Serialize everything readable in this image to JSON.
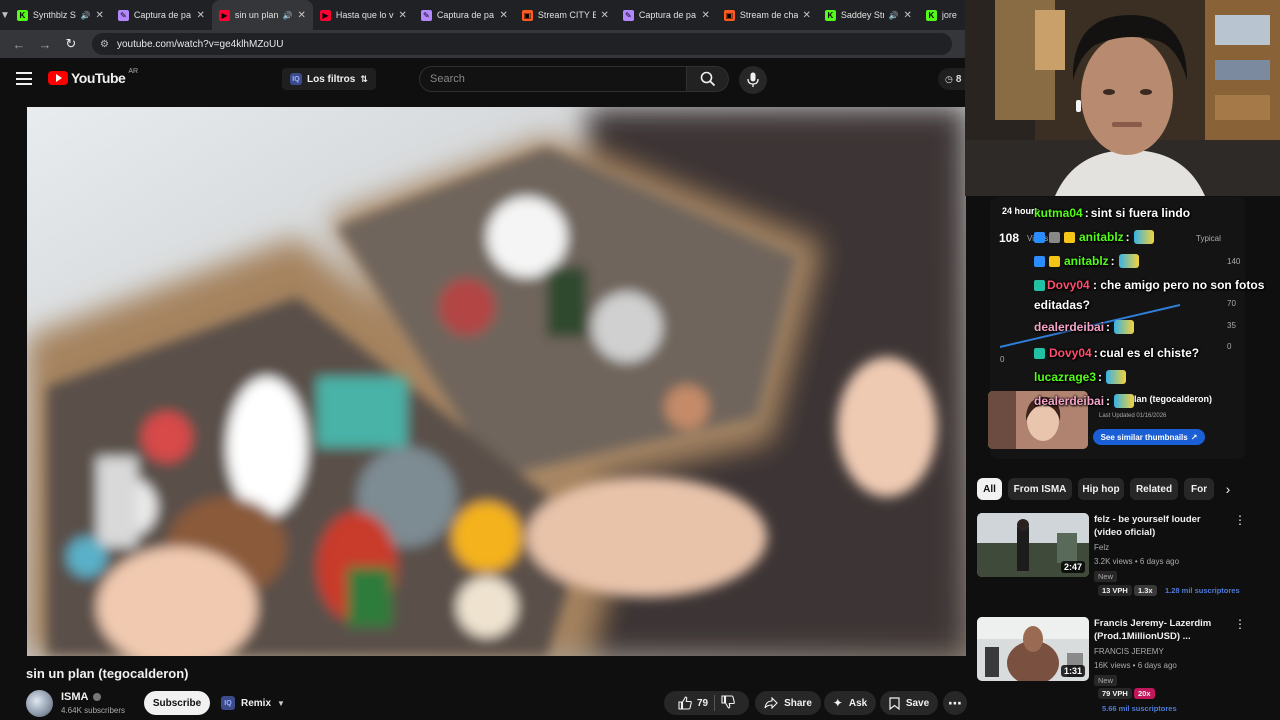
{
  "browser": {
    "tabs": [
      {
        "title": "Synthblz S",
        "favicon_color": "#53fc18",
        "favicon_glyph": "K",
        "audio": true,
        "active": false
      },
      {
        "title": "Captura de pa",
        "favicon_color": "#b388ff",
        "favicon_glyph": "✎",
        "audio": false,
        "active": false
      },
      {
        "title": "sin un plan",
        "favicon_color": "#ff0033",
        "favicon_glyph": "▶",
        "audio": true,
        "active": true
      },
      {
        "title": "Hasta que lo v",
        "favicon_color": "#ff0033",
        "favicon_glyph": "▶",
        "audio": false,
        "active": false
      },
      {
        "title": "Captura de pa",
        "favicon_color": "#b388ff",
        "favicon_glyph": "✎",
        "audio": false,
        "active": false
      },
      {
        "title": "Stream CITY B",
        "favicon_color": "#ff5a1f",
        "favicon_glyph": "▣",
        "audio": false,
        "active": false
      },
      {
        "title": "Captura de pa",
        "favicon_color": "#b388ff",
        "favicon_glyph": "✎",
        "audio": false,
        "active": false
      },
      {
        "title": "Stream de cha",
        "favicon_color": "#ff5a1f",
        "favicon_glyph": "▣",
        "audio": false,
        "active": false
      },
      {
        "title": "Saddey Str",
        "favicon_color": "#53fc18",
        "favicon_glyph": "K",
        "audio": true,
        "active": false
      },
      {
        "title": "jore",
        "favicon_color": "#53fc18",
        "favicon_glyph": "K",
        "audio": false,
        "active": false
      }
    ],
    "url": "youtube.com/watch?v=ge4klhMZoUU"
  },
  "header": {
    "logo_text": "YouTube",
    "country_code": "AR",
    "filters_label": "Los filtros",
    "search_placeholder": "Search",
    "timer_value": "8"
  },
  "video": {
    "title": "sin un plan (tegocalderon)",
    "channel_name": "ISMA",
    "subscribers": "4.64K subscribers",
    "subscribe_label": "Subscribe",
    "remix_label": "Remix",
    "likes": "79",
    "share_label": "Share",
    "ask_label": "Ask",
    "save_label": "Save"
  },
  "stats_panel": {
    "period": "24 hours",
    "views_value": "108",
    "views_label": "Views",
    "typical_label": "Typical",
    "y_ticks": [
      "140",
      "70",
      "35",
      "0"
    ],
    "zero_label": "0"
  },
  "chat": [
    {
      "user": "kutma04",
      "user_color": "#53fc18",
      "text": "sint si fuera lindo",
      "badges": [],
      "emotes": 0
    },
    {
      "user": "anitablz",
      "user_color": "#53fc18",
      "text": "",
      "badges": [
        "#2a8cff",
        "#888888",
        "#f5c518"
      ],
      "emotes": 1
    },
    {
      "user": "anitablz",
      "user_color": "#53fc18",
      "text": "",
      "badges": [
        "#2a8cff",
        "#f5c518"
      ],
      "emotes": 1
    },
    {
      "user": "Dovy04",
      "user_color": "#ff4d6d",
      "text": "che amigo pero no son fotos editadas?",
      "badges": [
        "#22c1a3"
      ],
      "emotes": 0
    },
    {
      "user": "dealerdeibai",
      "user_color": "#f5a4c8",
      "text": "",
      "badges": [],
      "emotes": 1
    },
    {
      "user": "Dovy04",
      "user_color": "#ff4d6d",
      "text": "cual es el chiste?",
      "badges": [
        "#22c1a3"
      ],
      "emotes": 0
    },
    {
      "user": "lucazrage3",
      "user_color": "#53fc18",
      "text": "",
      "badges": [],
      "emotes": 1
    },
    {
      "user": "dealerdeibai",
      "user_color": "#f5a4c8",
      "text": "",
      "badges": [],
      "emotes": 1
    }
  ],
  "thumbnail_card": {
    "title": "un plan (tegocalderon)",
    "updated": "Last Updated 01/16/2026",
    "button_label": "See similar thumbnails"
  },
  "filter_chips": [
    "All",
    "From ISMA",
    "Hip hop",
    "Related",
    "For"
  ],
  "recommendations": [
    {
      "title": "felz - be yourself louder (video oficial)",
      "channel": "Felz",
      "meta": "3.2K views • 6 days ago",
      "badge": "New",
      "duration": "2:47",
      "stat1": "13 VPH",
      "stat2": "1.3x",
      "stat3": "1.28 mil suscriptores",
      "stat2_color": "#3a3a3a",
      "stat3_color": "#4f7bd8"
    },
    {
      "title": "Francis Jeremy- Lazerdim (Prod.1MillionUSD) ...",
      "channel": "FRANCIS JEREMY",
      "meta": "16K views • 6 days ago",
      "badge": "New",
      "duration": "1:31",
      "stat1": "79 VPH",
      "stat2": "20x",
      "stat3": "5.66 mil suscriptores",
      "stat2_color": "#c2185b",
      "stat3_color": "#4f7bd8"
    }
  ]
}
